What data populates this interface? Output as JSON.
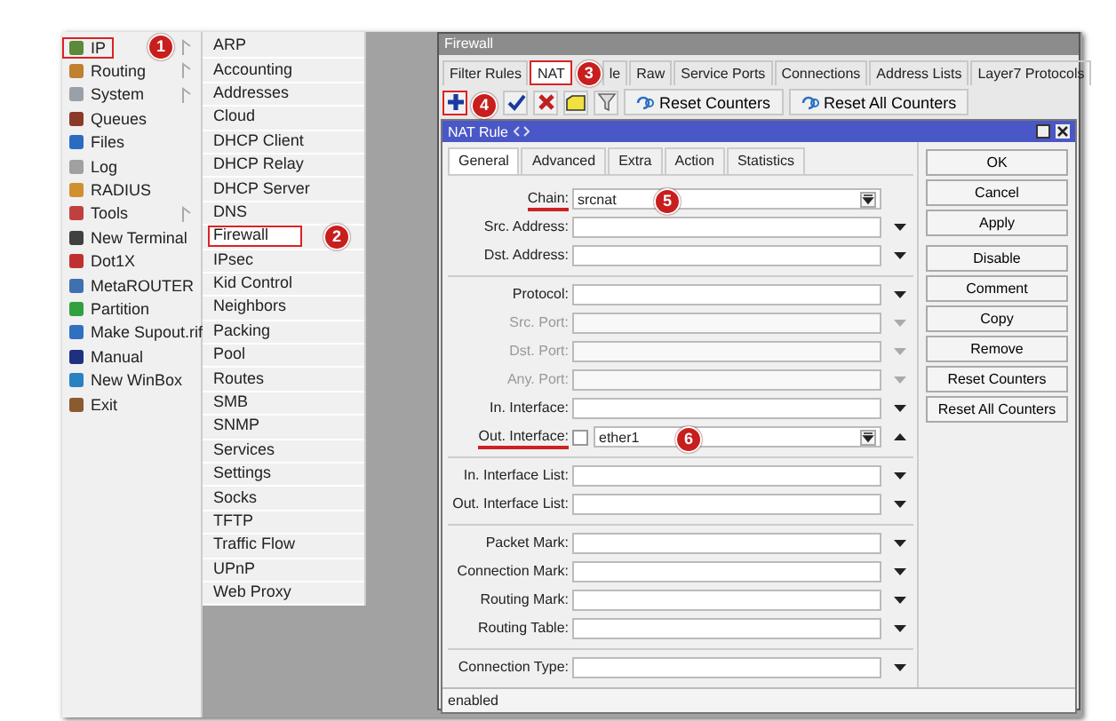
{
  "main_menu": [
    {
      "label": "IP",
      "submenu": true,
      "highlighted": true,
      "badge": "1"
    },
    {
      "label": "Routing",
      "submenu": true,
      "highlighted": false
    },
    {
      "label": "System",
      "submenu": true,
      "highlighted": false
    },
    {
      "label": "Queues",
      "submenu": false,
      "highlighted": false
    },
    {
      "label": "Files",
      "submenu": false,
      "highlighted": false
    },
    {
      "label": "Log",
      "submenu": false,
      "highlighted": false
    },
    {
      "label": "RADIUS",
      "submenu": false,
      "highlighted": false
    },
    {
      "label": "Tools",
      "submenu": true,
      "highlighted": false
    },
    {
      "label": "New Terminal",
      "submenu": false,
      "highlighted": false
    },
    {
      "label": "Dot1X",
      "submenu": false,
      "highlighted": false
    },
    {
      "label": "MetaROUTER",
      "submenu": false,
      "highlighted": false
    },
    {
      "label": "Partition",
      "submenu": false,
      "highlighted": false
    },
    {
      "label": "Make Supout.rif",
      "submenu": false,
      "highlighted": false
    },
    {
      "label": "Manual",
      "submenu": false,
      "highlighted": false
    },
    {
      "label": "New WinBox",
      "submenu": false,
      "highlighted": false
    },
    {
      "label": "Exit",
      "submenu": false,
      "highlighted": false
    }
  ],
  "submenu": [
    {
      "label": "ARP",
      "highlighted": false
    },
    {
      "label": "Accounting",
      "highlighted": false
    },
    {
      "label": "Addresses",
      "highlighted": false
    },
    {
      "label": "Cloud",
      "highlighted": false
    },
    {
      "label": "DHCP Client",
      "highlighted": false
    },
    {
      "label": "DHCP Relay",
      "highlighted": false
    },
    {
      "label": "DHCP Server",
      "highlighted": false
    },
    {
      "label": "DNS",
      "highlighted": false
    },
    {
      "label": "Firewall",
      "highlighted": true,
      "badge": "2"
    },
    {
      "label": "IPsec",
      "highlighted": false
    },
    {
      "label": "Kid Control",
      "highlighted": false
    },
    {
      "label": "Neighbors",
      "highlighted": false
    },
    {
      "label": "Packing",
      "highlighted": false
    },
    {
      "label": "Pool",
      "highlighted": false
    },
    {
      "label": "Routes",
      "highlighted": false
    },
    {
      "label": "SMB",
      "highlighted": false
    },
    {
      "label": "SNMP",
      "highlighted": false
    },
    {
      "label": "Services",
      "highlighted": false
    },
    {
      "label": "Settings",
      "highlighted": false
    },
    {
      "label": "Socks",
      "highlighted": false
    },
    {
      "label": "TFTP",
      "highlighted": false
    },
    {
      "label": "Traffic Flow",
      "highlighted": false
    },
    {
      "label": "UPnP",
      "highlighted": false
    },
    {
      "label": "Web Proxy",
      "highlighted": false
    }
  ],
  "firewall_window": {
    "title": "Firewall",
    "tabs": [
      {
        "label": "Filter Rules",
        "selected": false,
        "highlighted": false
      },
      {
        "label": "NAT",
        "selected": true,
        "highlighted": true,
        "badge": "3"
      },
      {
        "label": "le",
        "selected": false,
        "highlighted": false
      },
      {
        "label": "Raw",
        "selected": false,
        "highlighted": false
      },
      {
        "label": "Service Ports",
        "selected": false,
        "highlighted": false
      },
      {
        "label": "Connections",
        "selected": false,
        "highlighted": false
      },
      {
        "label": "Address Lists",
        "selected": false,
        "highlighted": false
      },
      {
        "label": "Layer7 Protocols",
        "selected": false,
        "highlighted": false
      }
    ],
    "toolbar": [
      {
        "kind": "add",
        "highlighted": true,
        "badge": "4"
      },
      {
        "kind": "enable",
        "highlighted": false
      },
      {
        "kind": "disable",
        "highlighted": false
      },
      {
        "kind": "comment",
        "highlighted": false
      },
      {
        "kind": "filter",
        "highlighted": false
      },
      {
        "kind": "button",
        "label": "Reset Counters",
        "highlighted": false
      },
      {
        "kind": "button",
        "label": "Reset All Counters",
        "highlighted": false
      }
    ]
  },
  "nat_rule": {
    "title": "NAT Rule",
    "tabs": [
      {
        "label": "General",
        "selected": true
      },
      {
        "label": "Advanced",
        "selected": false
      },
      {
        "label": "Extra",
        "selected": false
      },
      {
        "label": "Action",
        "selected": false
      },
      {
        "label": "Statistics",
        "selected": false
      }
    ],
    "field_groups": [
      [
        {
          "label": "Chain:",
          "kind": "combo",
          "value": "srcnat",
          "disabled": false,
          "underlined": true,
          "badge": "5"
        },
        {
          "label": "Src. Address:",
          "kind": "dropdown",
          "disabled": false,
          "underlined": false
        },
        {
          "label": "Dst. Address:",
          "kind": "dropdown",
          "disabled": false,
          "underlined": false
        }
      ],
      [
        {
          "label": "Protocol:",
          "kind": "dropdown",
          "disabled": false,
          "underlined": false
        },
        {
          "label": "Src. Port:",
          "kind": "dropdown",
          "disabled": true,
          "underlined": false
        },
        {
          "label": "Dst. Port:",
          "kind": "dropdown",
          "disabled": true,
          "underlined": false
        },
        {
          "label": "Any. Port:",
          "kind": "dropdown",
          "disabled": true,
          "underlined": false
        },
        {
          "label": "In. Interface:",
          "kind": "dropdown",
          "disabled": false,
          "underlined": false
        },
        {
          "label": "Out. Interface:",
          "kind": "negatable",
          "checked": false,
          "value": "ether1",
          "disabled": false,
          "underlined": true,
          "badge": "6"
        }
      ],
      [
        {
          "label": "In. Interface List:",
          "kind": "dropdown",
          "disabled": false,
          "underlined": false
        },
        {
          "label": "Out. Interface List:",
          "kind": "dropdown",
          "disabled": false,
          "underlined": false
        }
      ],
      [
        {
          "label": "Packet Mark:",
          "kind": "dropdown",
          "disabled": false,
          "underlined": false
        },
        {
          "label": "Connection Mark:",
          "kind": "dropdown",
          "disabled": false,
          "underlined": false
        },
        {
          "label": "Routing Mark:",
          "kind": "dropdown",
          "disabled": false,
          "underlined": false
        },
        {
          "label": "Routing Table:",
          "kind": "dropdown",
          "disabled": false,
          "underlined": false
        }
      ],
      [
        {
          "label": "Connection Type:",
          "kind": "dropdown",
          "disabled": false,
          "underlined": false
        }
      ]
    ],
    "buttons": [
      "OK",
      "Cancel",
      "Apply",
      "Disable",
      "Comment",
      "Copy",
      "Remove",
      "Reset Counters",
      "Reset All Counters"
    ],
    "status": "enabled"
  }
}
